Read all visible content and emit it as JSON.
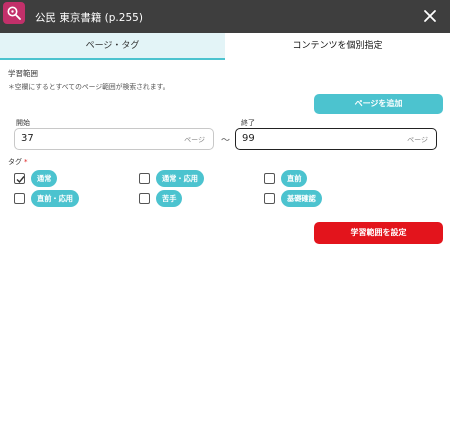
{
  "header": {
    "title": "公民 東京書籍 (p.255)",
    "app_icon": "magnifier-icon",
    "close_icon": "close-icon",
    "bg_color": "#3e3e3e",
    "icon_color": "#c2306a"
  },
  "tabs": [
    {
      "label": "ページ・タグ",
      "active": true
    },
    {
      "label": "コンテンツを個別指定",
      "active": false
    }
  ],
  "range": {
    "section_label": "学習範囲",
    "note": "＊空欄にするとすべてのページ範囲が検索されます。",
    "add_button": "ページを追加",
    "start_label": "開始",
    "start_value": "37",
    "start_unit": "ページ",
    "separator": "〜",
    "end_label": "終了",
    "end_value": "99",
    "end_unit": "ページ"
  },
  "tags": {
    "label": "タグ",
    "required_mark": "*",
    "items": [
      {
        "label": "通常",
        "checked": true
      },
      {
        "label": "通常・応用",
        "checked": false
      },
      {
        "label": "直前",
        "checked": false
      },
      {
        "label": "直前・応用",
        "checked": false
      },
      {
        "label": "苦手",
        "checked": false
      },
      {
        "label": "基礎確認",
        "checked": false
      }
    ]
  },
  "submit_button": "学習範囲を設定",
  "colors": {
    "accent": "#4cc3cf",
    "danger": "#e3141c",
    "tab_active_bg": "#e3f4f7"
  }
}
